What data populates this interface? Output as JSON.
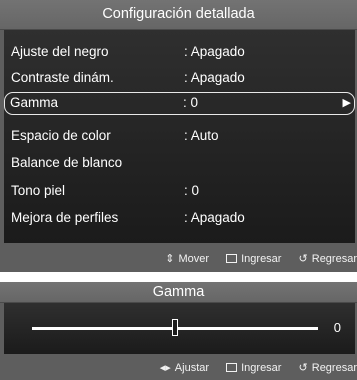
{
  "menu": {
    "title": "Configuración detallada",
    "items": [
      {
        "label": "Ajuste del negro",
        "value": ": Apagado"
      },
      {
        "label": "Contraste dinám.",
        "value": ": Apagado"
      },
      {
        "label": "Gamma",
        "value": ": 0",
        "selected": true
      },
      {
        "label": "Espacio de color",
        "value": ": Auto"
      },
      {
        "label": "Balance de blanco",
        "value": ""
      },
      {
        "label": "Tono piel",
        "value": ": 0"
      },
      {
        "label": "Mejora de perfiles",
        "value": ": Apagado"
      }
    ],
    "footer": {
      "move_icon": "⇕",
      "move": "Mover",
      "enter": "Ingresar",
      "return_icon": "↺",
      "return": "Regresar"
    }
  },
  "gamma": {
    "title": "Gamma",
    "value": "0",
    "level": 0.5,
    "footer": {
      "adjust_icon": "◂▸",
      "adjust": "Ajustar",
      "enter": "Ingresar",
      "return_icon": "↺",
      "return": "Regresar"
    }
  },
  "colors": {
    "panel": "#5e5e5e",
    "inner": "#232323",
    "text": "#ffffff"
  }
}
